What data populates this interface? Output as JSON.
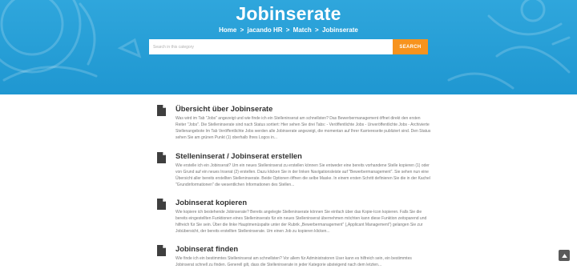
{
  "hero": {
    "title": "Jobinserate",
    "breadcrumb": {
      "items": [
        "Home",
        "jacando HR",
        "Match",
        "Jobinserate"
      ],
      "separator": ">"
    },
    "search": {
      "placeholder": "Search in this category",
      "button_label": "SEARCH"
    }
  },
  "colors": {
    "hero_bg": "#1f97d1",
    "accent": "#f7931e",
    "title": "#333333",
    "text": "#777777"
  },
  "articles": [
    {
      "title": "Übersicht über Jobinserate",
      "text": "Was wird im Tab \"Jobs\" angezeigt und wie finde ich ein Stelleninserat am schnellsten? Das Bewerbermanagement öffnet direkt den ersten Reiter \"Jobs\". Die Stelleninserate sind nach Status sortiert: Hier sehen Sie drei Tabs: - Veröffentlichte Jobs - Unveröffentlichte Jobs - Archivierte Stellenangebote Im Tab Veröffentlichte Jobs werden alle Jobinserate angezeigt, die momentan auf Ihrer Karriereseite publiziert sind. Den Status sehen Sie am grünen Punkt (1) oberhalb Ihres Logos in..."
    },
    {
      "title": "Stelleninserat / Jobinserat erstellen",
      "text": "Wie erstelle ich ein Jobinserat? Um ein neues Stelleninserat zu erstellen können Sie entweder eine bereits vorhandene Stelle kopieren (1) oder von Grund auf ein neues Inserat (2) erstellen. Dazu klicken Sie in der linken Navigationsleiste auf \"Bewerbermanagement\". Sie sehen nun eine Übersicht aller bereits erstellten Stelleninserate. Beide Optionen öffnen die selbe Maske. In einem ersten Schritt definieren Sie die in der Kachel \"Grundinformationen\" die wesentlichen Informationen des Stellen..."
    },
    {
      "title": "Jobinserat kopieren",
      "text": "Wie kopiere ich bestehende Jobinserate? Bereits angelegte Stelleninserate können Sie einfach über das Kopie-Icon kopieren. Falls Sie die bereits eingestellten Funktionen eines Stelleninserats für ein neues Stelleninserat übernehmen möchten kann diese Funktion zeitsparend und hilfreich für Sie sein. Über die linke Hauptmenüspalte unter der Rubrik „Bewerbermanagement\" („Applicant Management\") gelangen Sie zur Jobübersicht, der bereits erstellten Stelleninserate. Um einen Job zu kopieren klicken..."
    },
    {
      "title": "Jobinserat finden",
      "text": "Wie finde ich ein bestimmtes Stelleninserat am schnellsten? Vor allem für Administratoren User kann es hilfreich sein, ein bestimmtes Jobinserat schnell zu finden. Generell gilt, dass die Stelleninserate in jeder Kategorie absteigend nach dem letzten..."
    }
  ]
}
